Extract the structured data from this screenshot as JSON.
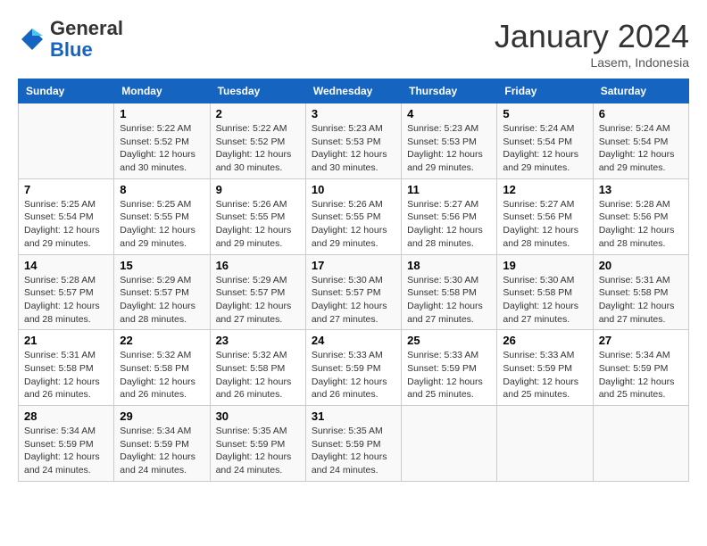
{
  "header": {
    "logo_general": "General",
    "logo_blue": "Blue",
    "month_title": "January 2024",
    "location": "Lasem, Indonesia"
  },
  "weekdays": [
    "Sunday",
    "Monday",
    "Tuesday",
    "Wednesday",
    "Thursday",
    "Friday",
    "Saturday"
  ],
  "weeks": [
    [
      {
        "day": "",
        "info": ""
      },
      {
        "day": "1",
        "info": "Sunrise: 5:22 AM\nSunset: 5:52 PM\nDaylight: 12 hours\nand 30 minutes."
      },
      {
        "day": "2",
        "info": "Sunrise: 5:22 AM\nSunset: 5:52 PM\nDaylight: 12 hours\nand 30 minutes."
      },
      {
        "day": "3",
        "info": "Sunrise: 5:23 AM\nSunset: 5:53 PM\nDaylight: 12 hours\nand 30 minutes."
      },
      {
        "day": "4",
        "info": "Sunrise: 5:23 AM\nSunset: 5:53 PM\nDaylight: 12 hours\nand 29 minutes."
      },
      {
        "day": "5",
        "info": "Sunrise: 5:24 AM\nSunset: 5:54 PM\nDaylight: 12 hours\nand 29 minutes."
      },
      {
        "day": "6",
        "info": "Sunrise: 5:24 AM\nSunset: 5:54 PM\nDaylight: 12 hours\nand 29 minutes."
      }
    ],
    [
      {
        "day": "7",
        "info": "Sunrise: 5:25 AM\nSunset: 5:54 PM\nDaylight: 12 hours\nand 29 minutes."
      },
      {
        "day": "8",
        "info": "Sunrise: 5:25 AM\nSunset: 5:55 PM\nDaylight: 12 hours\nand 29 minutes."
      },
      {
        "day": "9",
        "info": "Sunrise: 5:26 AM\nSunset: 5:55 PM\nDaylight: 12 hours\nand 29 minutes."
      },
      {
        "day": "10",
        "info": "Sunrise: 5:26 AM\nSunset: 5:55 PM\nDaylight: 12 hours\nand 29 minutes."
      },
      {
        "day": "11",
        "info": "Sunrise: 5:27 AM\nSunset: 5:56 PM\nDaylight: 12 hours\nand 28 minutes."
      },
      {
        "day": "12",
        "info": "Sunrise: 5:27 AM\nSunset: 5:56 PM\nDaylight: 12 hours\nand 28 minutes."
      },
      {
        "day": "13",
        "info": "Sunrise: 5:28 AM\nSunset: 5:56 PM\nDaylight: 12 hours\nand 28 minutes."
      }
    ],
    [
      {
        "day": "14",
        "info": "Sunrise: 5:28 AM\nSunset: 5:57 PM\nDaylight: 12 hours\nand 28 minutes."
      },
      {
        "day": "15",
        "info": "Sunrise: 5:29 AM\nSunset: 5:57 PM\nDaylight: 12 hours\nand 28 minutes."
      },
      {
        "day": "16",
        "info": "Sunrise: 5:29 AM\nSunset: 5:57 PM\nDaylight: 12 hours\nand 27 minutes."
      },
      {
        "day": "17",
        "info": "Sunrise: 5:30 AM\nSunset: 5:57 PM\nDaylight: 12 hours\nand 27 minutes."
      },
      {
        "day": "18",
        "info": "Sunrise: 5:30 AM\nSunset: 5:58 PM\nDaylight: 12 hours\nand 27 minutes."
      },
      {
        "day": "19",
        "info": "Sunrise: 5:30 AM\nSunset: 5:58 PM\nDaylight: 12 hours\nand 27 minutes."
      },
      {
        "day": "20",
        "info": "Sunrise: 5:31 AM\nSunset: 5:58 PM\nDaylight: 12 hours\nand 27 minutes."
      }
    ],
    [
      {
        "day": "21",
        "info": "Sunrise: 5:31 AM\nSunset: 5:58 PM\nDaylight: 12 hours\nand 26 minutes."
      },
      {
        "day": "22",
        "info": "Sunrise: 5:32 AM\nSunset: 5:58 PM\nDaylight: 12 hours\nand 26 minutes."
      },
      {
        "day": "23",
        "info": "Sunrise: 5:32 AM\nSunset: 5:58 PM\nDaylight: 12 hours\nand 26 minutes."
      },
      {
        "day": "24",
        "info": "Sunrise: 5:33 AM\nSunset: 5:59 PM\nDaylight: 12 hours\nand 26 minutes."
      },
      {
        "day": "25",
        "info": "Sunrise: 5:33 AM\nSunset: 5:59 PM\nDaylight: 12 hours\nand 25 minutes."
      },
      {
        "day": "26",
        "info": "Sunrise: 5:33 AM\nSunset: 5:59 PM\nDaylight: 12 hours\nand 25 minutes."
      },
      {
        "day": "27",
        "info": "Sunrise: 5:34 AM\nSunset: 5:59 PM\nDaylight: 12 hours\nand 25 minutes."
      }
    ],
    [
      {
        "day": "28",
        "info": "Sunrise: 5:34 AM\nSunset: 5:59 PM\nDaylight: 12 hours\nand 24 minutes."
      },
      {
        "day": "29",
        "info": "Sunrise: 5:34 AM\nSunset: 5:59 PM\nDaylight: 12 hours\nand 24 minutes."
      },
      {
        "day": "30",
        "info": "Sunrise: 5:35 AM\nSunset: 5:59 PM\nDaylight: 12 hours\nand 24 minutes."
      },
      {
        "day": "31",
        "info": "Sunrise: 5:35 AM\nSunset: 5:59 PM\nDaylight: 12 hours\nand 24 minutes."
      },
      {
        "day": "",
        "info": ""
      },
      {
        "day": "",
        "info": ""
      },
      {
        "day": "",
        "info": ""
      }
    ]
  ]
}
